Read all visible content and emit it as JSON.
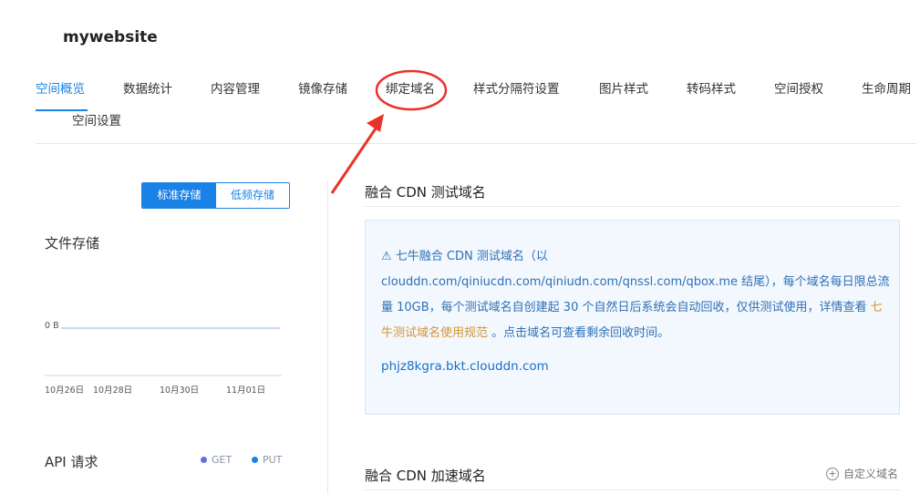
{
  "site": {
    "title": "mywebsite"
  },
  "tabs": [
    {
      "label": "空间概览"
    },
    {
      "label": "数据统计"
    },
    {
      "label": "内容管理"
    },
    {
      "label": "镜像存储"
    },
    {
      "label": "绑定域名"
    },
    {
      "label": "样式分隔符设置"
    },
    {
      "label": "图片样式"
    },
    {
      "label": "转码样式"
    },
    {
      "label": "空间授权"
    },
    {
      "label": "生命周期"
    },
    {
      "label": "空间设置"
    }
  ],
  "active_tab": "空间概览",
  "storage_toggle": {
    "standard": "标准存储",
    "low_freq": "低频存储",
    "selected": "标准存储"
  },
  "file_storage": {
    "title": "文件存储",
    "y_label": "0 B",
    "x_ticks": [
      "10月26日",
      "10月28日",
      "10月30日",
      "11月01日"
    ]
  },
  "api_requests": {
    "title": "API 请求",
    "legend": [
      {
        "name": "GET",
        "color": "#6c6cd8"
      },
      {
        "name": "PUT",
        "color": "#1a82e6"
      }
    ]
  },
  "test_domain": {
    "title": "融合 CDN 测试域名",
    "warn_icon": "warning-icon",
    "notice_prefix": "七牛融合 CDN 测试域名（以 clouddn.com/qiniucdn.com/qiniudn.com/qnssl.com/qbox.me 结尾），每个域名每日限总流量 10GB，每个测试域名自创建起 30 个自然日后系统会自动回收，仅供测试使用，详情查看 ",
    "rule_link": "七牛测试域名使用规范",
    "notice_suffix": " 。点击域名可查看剩余回收时间。",
    "domain": "phjz8kgra.bkt.clouddn.com"
  },
  "accel_domain": {
    "title": "融合 CDN 加速域名",
    "custom_button": "自定义域名"
  },
  "colors": {
    "accent": "#1a82e6",
    "annotation": "#e8332a",
    "rule_link": "#d79435"
  }
}
